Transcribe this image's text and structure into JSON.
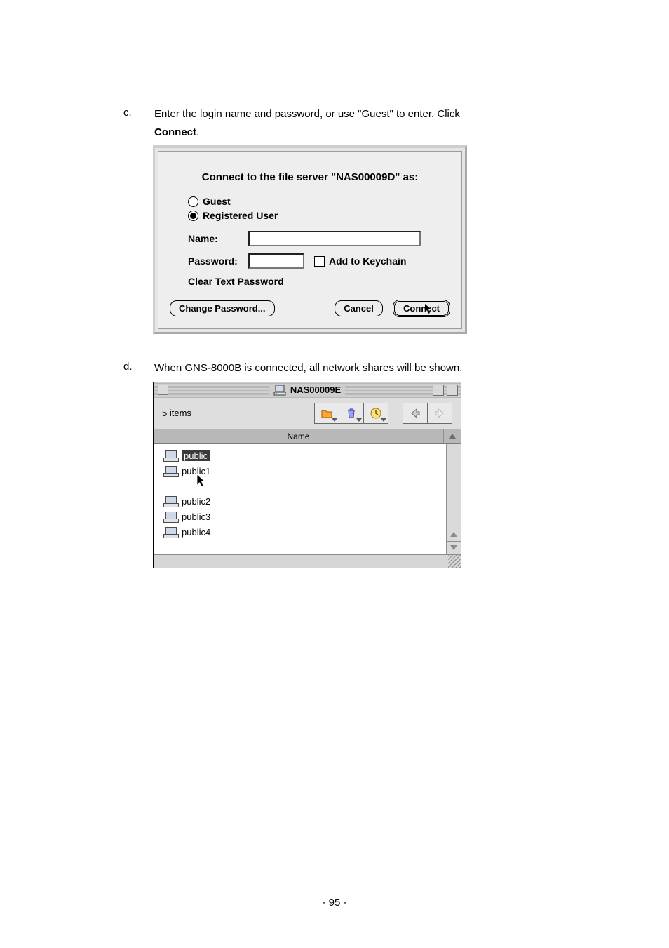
{
  "steps": {
    "c": {
      "letter": "c.",
      "text_1": "Enter the login name and password, or use \"Guest\" to enter.  Click ",
      "bold": "Connect",
      "text_2": "."
    },
    "d": {
      "letter": "d.",
      "text_1": "When GNS-8000B is connected, all network shares will be shown."
    }
  },
  "dialog1": {
    "title": "Connect to the file server \"NAS00009D\" as:",
    "radio_guest": "Guest",
    "radio_registered": "Registered User",
    "name_label": "Name:",
    "name_value": "",
    "password_label": "Password:",
    "password_value": "",
    "add_to_keychain": "Add to Keychain",
    "clear_text_pw": "Clear Text Password",
    "btn_change_pw": "Change Password...",
    "btn_cancel": "Cancel",
    "btn_connect": "Connect"
  },
  "window2": {
    "title": "NAS00009E",
    "items_text": "5 items",
    "col_name": "Name",
    "shares": [
      "public",
      "public1",
      "public2",
      "public3",
      "public4"
    ],
    "selected_index": 0
  },
  "page_number": "- 95 -"
}
